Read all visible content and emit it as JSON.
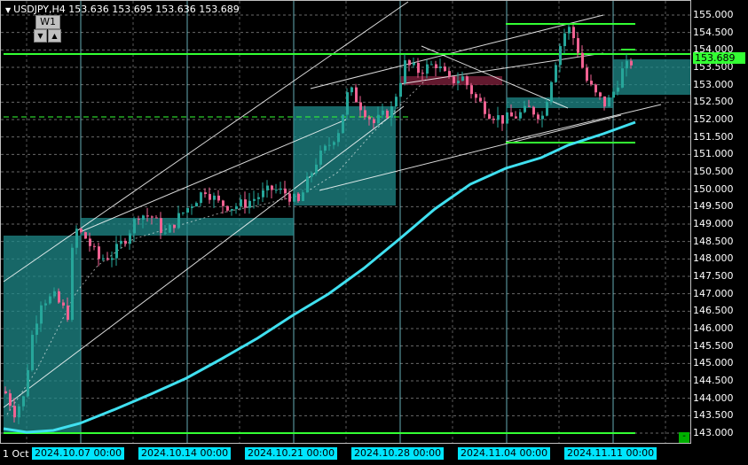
{
  "header": {
    "symbol_line": "USDJPY,H4  153.636 153.695 153.636 153.689",
    "timeframe": "W1",
    "btn_down": "▼",
    "btn_up": "▲"
  },
  "price_axis": {
    "labels": [
      "155.000",
      "154.500",
      "154.000",
      "153.500",
      "153.000",
      "152.500",
      "152.000",
      "151.500",
      "151.000",
      "150.500",
      "150.000",
      "149.500",
      "149.000",
      "148.500",
      "148.000",
      "147.500",
      "147.000",
      "146.500",
      "146.000",
      "145.500",
      "145.000",
      "144.500",
      "144.000",
      "143.500",
      "143.000"
    ],
    "current_price": "153.689",
    "badge_price_1": "153.689"
  },
  "time_axis": {
    "first_label": "1 Oct",
    "boxed_labels": [
      "2024.10.07 00:00",
      "2024.10.14 00:00",
      "2024.10.21 00:00",
      "2024.10.28 00:00",
      "2024.11.04 00:00",
      "2024.11.11 00:00"
    ]
  },
  "colors": {
    "background": "#000000",
    "grid": "#b0b0b0",
    "bull": "#26a69a",
    "bear": "#f06292",
    "ma": "#40e0f0",
    "level": "#33ff33",
    "zone": "#1f8a8a",
    "zone_bear": "#7a1f3a"
  },
  "indicator": {
    "corner_button": "-"
  }
}
